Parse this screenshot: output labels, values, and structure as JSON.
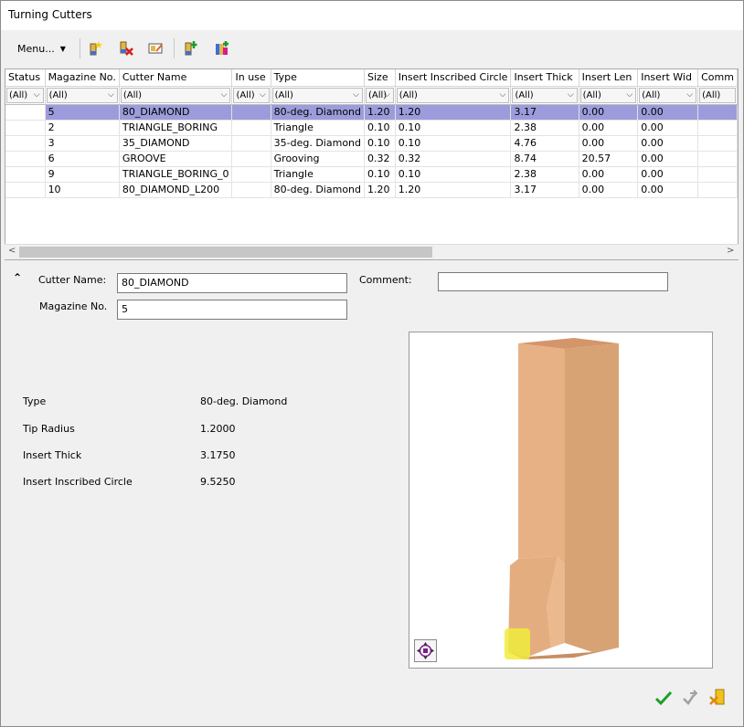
{
  "window": {
    "title": "Turning Cutters"
  },
  "toolbar": {
    "menu_label": "Menu...",
    "buttons": [
      "new-cutter-icon",
      "delete-cutter-icon",
      "edit-cutter-icon",
      "import-cutter-icon",
      "export-cutter-icon"
    ]
  },
  "grid": {
    "columns": [
      "Status",
      "Magazine No.",
      "Cutter Name",
      "In use",
      "Type",
      "Size",
      "Insert Inscribed Circle",
      "Insert Thick",
      "Insert Len",
      "Insert Wid",
      "Comm"
    ],
    "filters": [
      "(All)",
      "(All)",
      "(All)",
      "(All)",
      "(All)",
      "(All)",
      "(All)",
      "(All)",
      "(All)",
      "(All)",
      "(All)"
    ],
    "rows": [
      {
        "status": "",
        "magazine": "5",
        "name": "80_DIAMOND",
        "in_use": "",
        "type": "80-deg. Diamond",
        "size": "1.20",
        "circle": "1.20",
        "thick": "3.17",
        "len": "0.00",
        "wid": "0.00",
        "comment": ""
      },
      {
        "status": "",
        "magazine": "2",
        "name": "TRIANGLE_BORING",
        "in_use": "",
        "type": "Triangle",
        "size": "0.10",
        "circle": "0.10",
        "thick": "2.38",
        "len": "0.00",
        "wid": "0.00",
        "comment": ""
      },
      {
        "status": "",
        "magazine": "3",
        "name": "35_DIAMOND",
        "in_use": "",
        "type": "35-deg. Diamond",
        "size": "0.10",
        "circle": "0.10",
        "thick": "4.76",
        "len": "0.00",
        "wid": "0.00",
        "comment": ""
      },
      {
        "status": "",
        "magazine": "6",
        "name": "GROOVE",
        "in_use": "",
        "type": "Grooving",
        "size": "0.32",
        "circle": "0.32",
        "thick": "8.74",
        "len": "20.57",
        "wid": "0.00",
        "comment": ""
      },
      {
        "status": "",
        "magazine": "9",
        "name": "TRIANGLE_BORING_0",
        "in_use": "",
        "type": "Triangle",
        "size": "0.10",
        "circle": "0.10",
        "thick": "2.38",
        "len": "0.00",
        "wid": "0.00",
        "comment": ""
      },
      {
        "status": "",
        "magazine": "10",
        "name": "80_DIAMOND_L200",
        "in_use": "",
        "type": "80-deg. Diamond",
        "size": "1.20",
        "circle": "1.20",
        "thick": "3.17",
        "len": "0.00",
        "wid": "0.00",
        "comment": ""
      }
    ],
    "selected_row": 0
  },
  "details": {
    "cutter_name_label": "Cutter Name:",
    "cutter_name_value": "80_DIAMOND",
    "magazine_label": "Magazine No.",
    "magazine_value": "5",
    "comment_label": "Comment:",
    "comment_value": "",
    "properties": [
      {
        "name": "Type",
        "value": "80-deg. Diamond"
      },
      {
        "name": "Tip Radius",
        "value": "1.2000"
      },
      {
        "name": "Insert Thick",
        "value": "3.1750"
      },
      {
        "name": "Insert Inscribed Circle",
        "value": "9.5250"
      }
    ]
  },
  "colors": {
    "selection": "#9c9cdc",
    "tool_body": "#e8b185",
    "insert_highlight": "#f0ec3c"
  },
  "footer": {
    "buttons": [
      "ok-check-icon",
      "apply-icon",
      "cancel-icon"
    ]
  }
}
